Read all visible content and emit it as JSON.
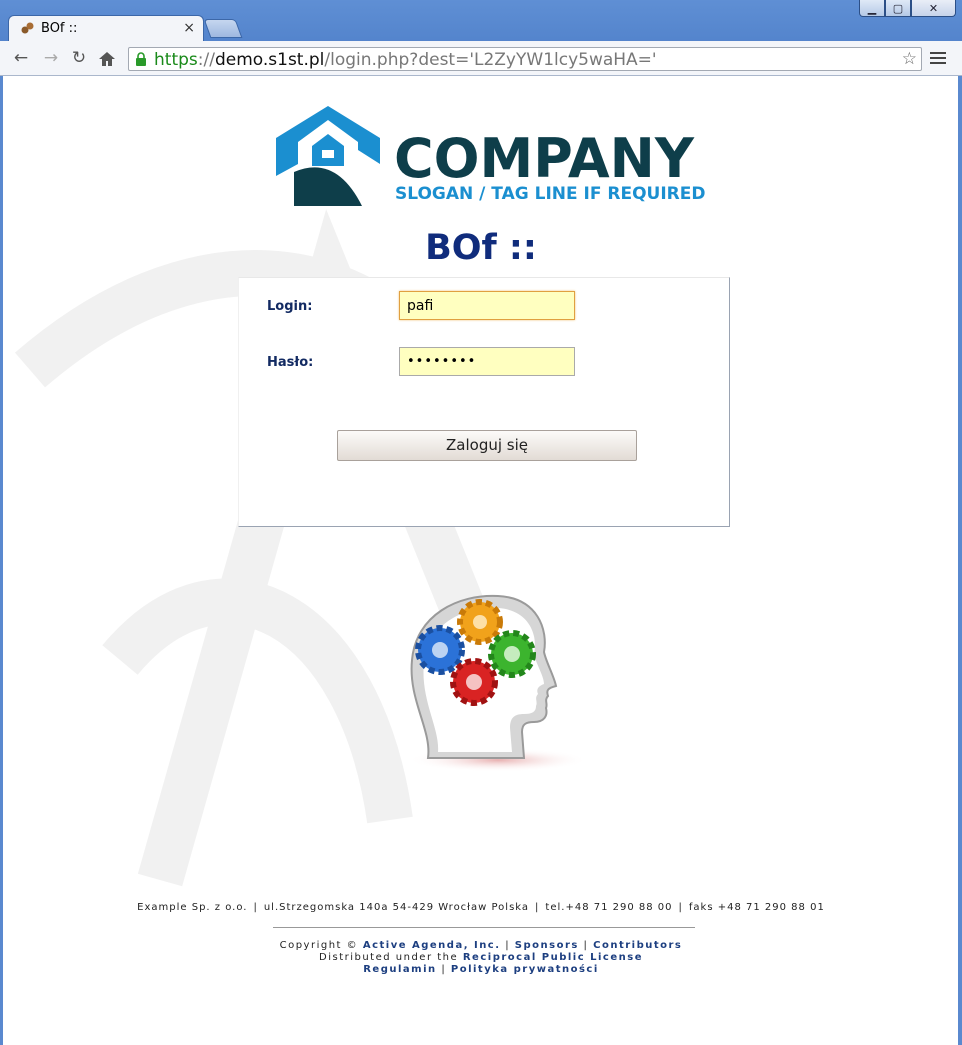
{
  "browser": {
    "tab_title": "BOf ::",
    "tab_close": "×",
    "url_scheme": "https",
    "url_sep": "://",
    "url_host": "demo.s1st.pl",
    "url_path": "/login.php?dest='L2ZyYW1lcy5waHA='",
    "window_minimize": "▁",
    "window_restore": "▢",
    "window_close": "✕"
  },
  "logo": {
    "company": "COMPANY",
    "slogan": "SLOGAN / TAG LINE IF REQUIRED"
  },
  "page_title": "BOf ::",
  "login_form": {
    "login_label": "Login:",
    "login_value": "pafi",
    "password_label": "Hasło:",
    "password_value": "••••••••",
    "submit_label": "Zaloguj się"
  },
  "footer": {
    "company": "Example Sp. z o.o.",
    "address": "ul.Strzegomska 140a 54-429 Wrocław Polska",
    "phone": "tel.+48 71 290 88 00",
    "fax": "faks +48 71 290 88 01",
    "separator": "|",
    "copyright_prefix": "Copyright ©",
    "copyright_link": "Active Agenda, Inc.",
    "sponsors": "Sponsors",
    "contributors": "Contributors",
    "distributed_prefix": "Distributed under the",
    "license_link": "Reciprocal Public License",
    "regulamin": "Regulamin",
    "privacy": "Polityka prywatności"
  },
  "colors": {
    "title": "#102c7c",
    "logo_blue": "#1b8fd0",
    "logo_dark": "#0e3e4a",
    "field_bg": "#ffffc0"
  }
}
